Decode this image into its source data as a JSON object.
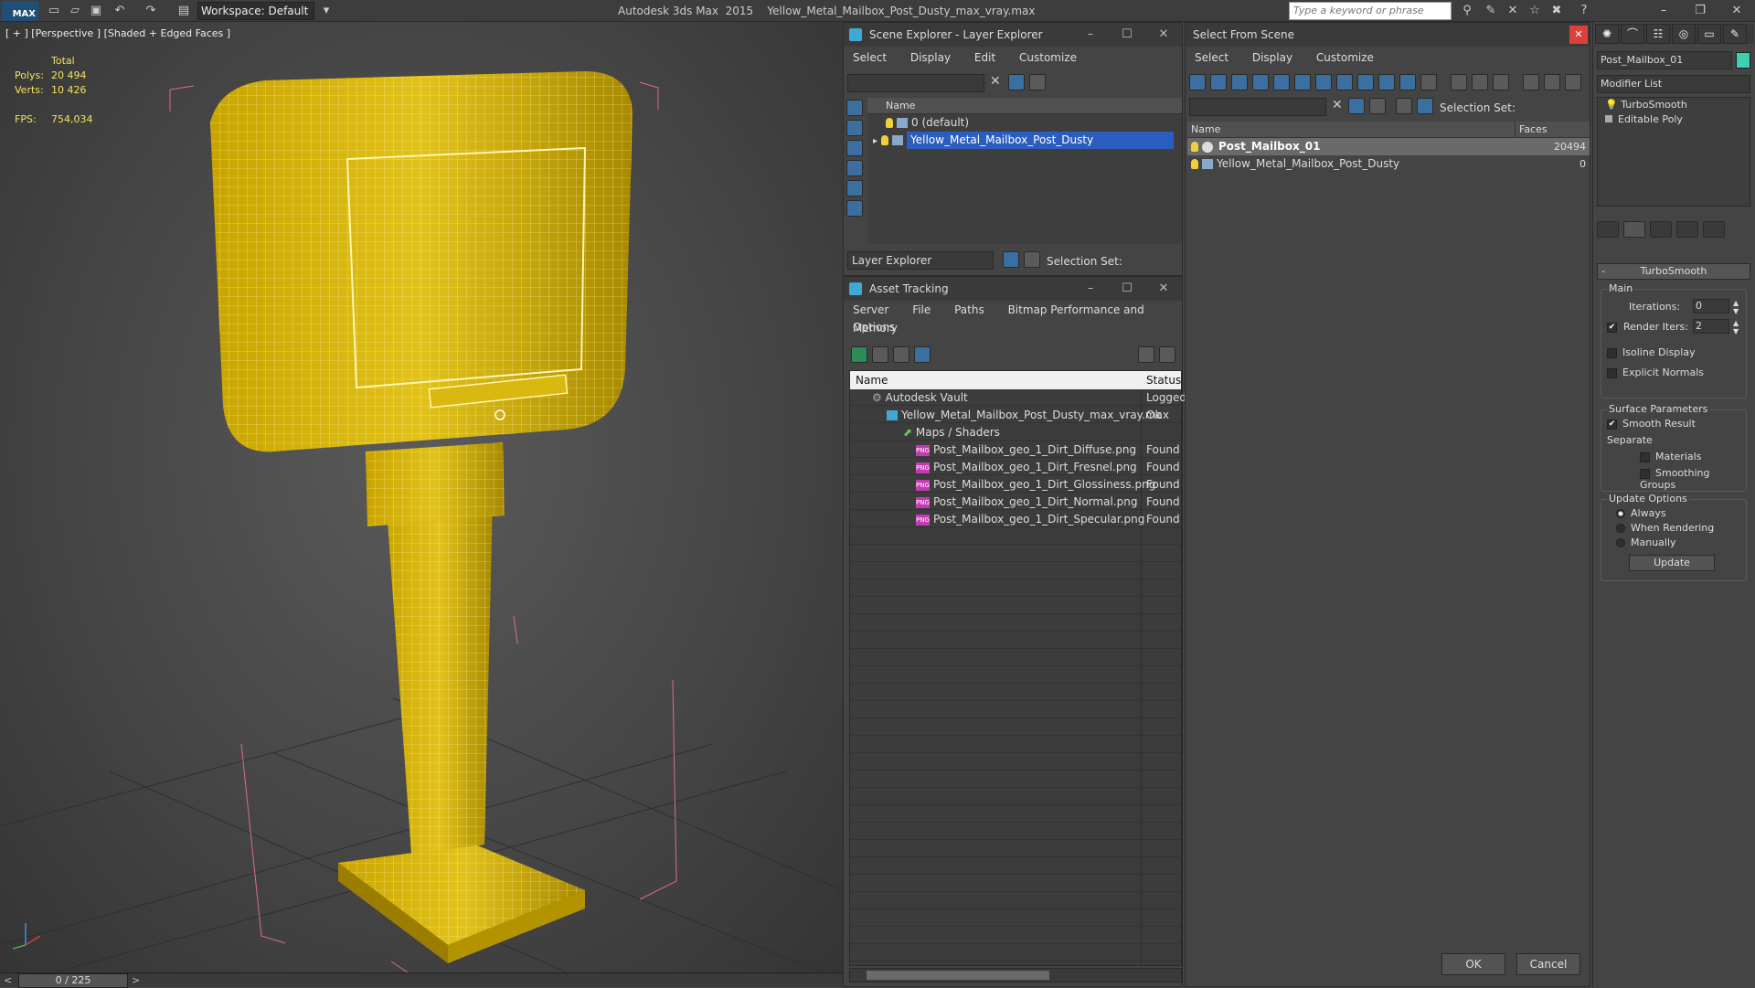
{
  "app": {
    "workspace": "Workspace: Default",
    "title": "Autodesk 3ds Max  2015    Yellow_Metal_Mailbox_Post_Dusty_max_vray.max",
    "search_placeholder": "Type a keyword or phrase",
    "logo": "MAX"
  },
  "viewport": {
    "label": "[ + ] [Perspective ] [Shaded + Edged Faces ]",
    "total_label": "Total",
    "polys_label": "Polys:",
    "polys_value": "20 494",
    "verts_label": "Verts:",
    "verts_value": "10 426",
    "fps_label": "FPS:",
    "fps_value": "754,034"
  },
  "timeline": {
    "frame": "0 / 225",
    "prev": "<",
    "next": ">"
  },
  "scene_explorer": {
    "title": "Scene Explorer - Layer Explorer",
    "menu": [
      "Select",
      "Display",
      "Edit",
      "Customize"
    ],
    "col_name": "Name",
    "rows": [
      {
        "label": "0 (default)"
      },
      {
        "label": "Yellow_Metal_Mailbox_Post_Dusty"
      }
    ],
    "footer_label": "Layer Explorer",
    "selection_set": "Selection Set:"
  },
  "asset_tracking": {
    "title": "Asset Tracking",
    "menu": [
      "Server",
      "File",
      "Paths",
      "Bitmap Performance and Memory"
    ],
    "menu2": "Options",
    "col_name": "Name",
    "col_status": "Status",
    "rows": [
      {
        "name": "Autodesk Vault",
        "status": "Logged"
      },
      {
        "name": "Yellow_Metal_Mailbox_Post_Dusty_max_vray.max",
        "status": "Ok"
      },
      {
        "name": "Maps / Shaders",
        "status": ""
      },
      {
        "name": "Post_Mailbox_geo_1_Dirt_Diffuse.png",
        "status": "Found"
      },
      {
        "name": "Post_Mailbox_geo_1_Dirt_Fresnel.png",
        "status": "Found"
      },
      {
        "name": "Post_Mailbox_geo_1_Dirt_Glossiness.png",
        "status": "Found"
      },
      {
        "name": "Post_Mailbox_geo_1_Dirt_Normal.png",
        "status": "Found"
      },
      {
        "name": "Post_Mailbox_geo_1_Dirt_Specular.png",
        "status": "Found"
      }
    ]
  },
  "select_from_scene": {
    "title": "Select From Scene",
    "menu": [
      "Select",
      "Display",
      "Customize"
    ],
    "selection_set": "Selection Set:",
    "col_name": "Name",
    "col_faces": "Faces",
    "rows": [
      {
        "name": "Post_Mailbox_01",
        "faces": "20494"
      },
      {
        "name": "Yellow_Metal_Mailbox_Post_Dusty",
        "faces": "0"
      }
    ],
    "ok": "OK",
    "cancel": "Cancel"
  },
  "command_panel": {
    "object_name": "Post_Mailbox_01",
    "object_color": "#3ed0b0",
    "modifier_list": "Modifier List",
    "stack": [
      "TurboSmooth",
      "Editable Poly"
    ],
    "rollout_title": "TurboSmooth",
    "main_label": "Main",
    "iterations_label": "Iterations:",
    "iterations_value": "0",
    "render_iters_label": "Render Iters:",
    "render_iters_value": "2",
    "isoline_label": "Isoline Display",
    "explicit_normals_label": "Explicit Normals",
    "surface_label": "Surface Parameters",
    "smooth_result_label": "Smooth Result",
    "separate_label": "Separate",
    "materials_label": "Materials",
    "smoothing_groups_label": "Smoothing Groups",
    "update_options_label": "Update Options",
    "always_label": "Always",
    "when_rendering_label": "When Rendering",
    "manually_label": "Manually",
    "update_button": "Update"
  }
}
